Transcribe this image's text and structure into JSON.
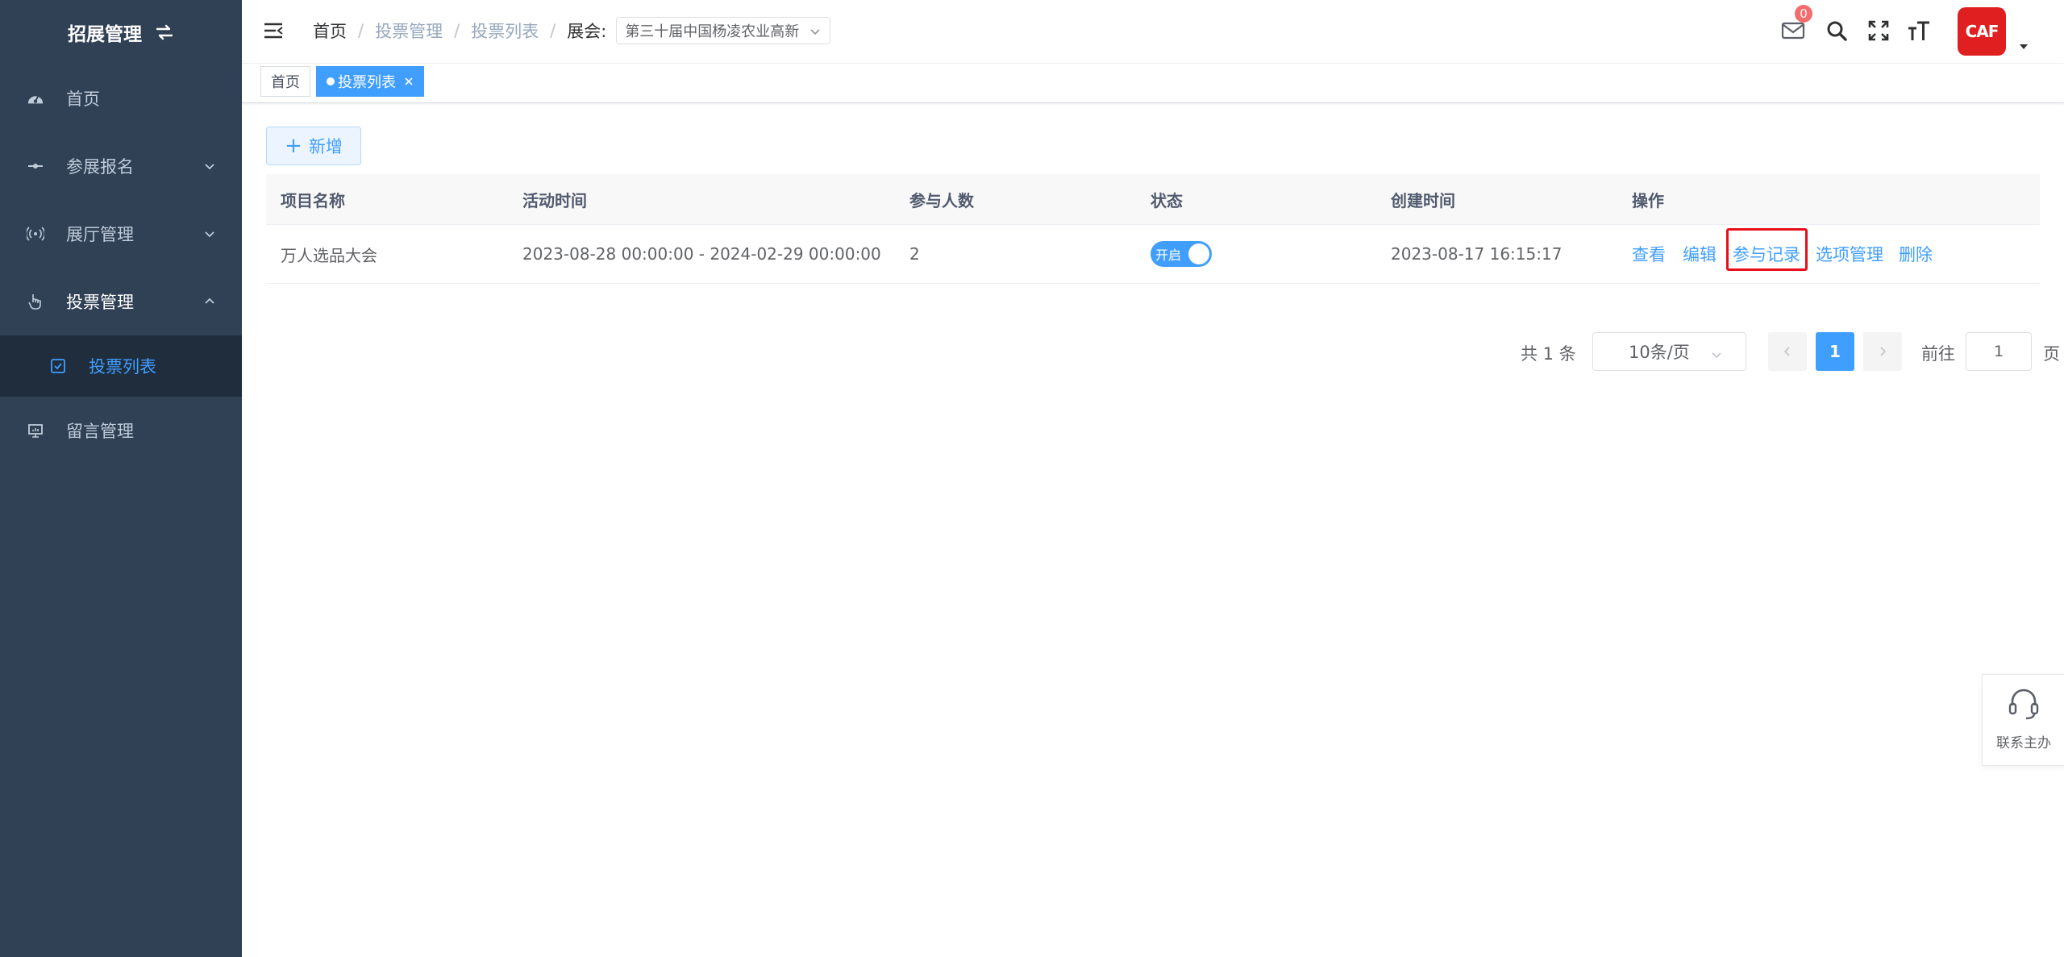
{
  "sidebar": {
    "title": "招展管理",
    "items": [
      {
        "label": "首页",
        "icon": "dashboard-icon"
      },
      {
        "label": "参展报名",
        "icon": "signup-icon"
      },
      {
        "label": "展厅管理",
        "icon": "broadcast-icon"
      },
      {
        "label": "投票管理",
        "icon": "hand-pointer-icon"
      },
      {
        "label": "投票列表",
        "icon": "checkbox-icon"
      },
      {
        "label": "留言管理",
        "icon": "monitor-icon"
      }
    ]
  },
  "header": {
    "breadcrumb": [
      "首页",
      "投票管理",
      "投票列表"
    ],
    "expo_label": "展会:",
    "expo_value": "第三十届中国杨凌农业高新",
    "badge_count": "0",
    "avatar_text": "CAF"
  },
  "tags": {
    "home": "首页",
    "active": "投票列表"
  },
  "toolbar": {
    "add_label": "新增"
  },
  "table": {
    "columns": [
      "项目名称",
      "活动时间",
      "参与人数",
      "状态",
      "创建时间",
      "操作"
    ],
    "rows": [
      {
        "name": "万人选品大会",
        "time": "2023-08-28 00:00:00 - 2024-02-29 00:00:00",
        "count": "2",
        "status_text": "开启",
        "status_on": true,
        "created": "2023-08-17 16:15:17",
        "ops": [
          "查看",
          "编辑",
          "参与记录",
          "选项管理",
          "删除"
        ]
      }
    ]
  },
  "pagination": {
    "total": "共 1 条",
    "page_size": "10条/页",
    "current": "1",
    "goto_label": "前往",
    "goto_value": "1",
    "page_label": "页"
  },
  "contact": {
    "label": "联系主办"
  },
  "colors": {
    "sidebar_bg": "#304156",
    "primary": "#409eff",
    "highlight": "#e6101a"
  }
}
